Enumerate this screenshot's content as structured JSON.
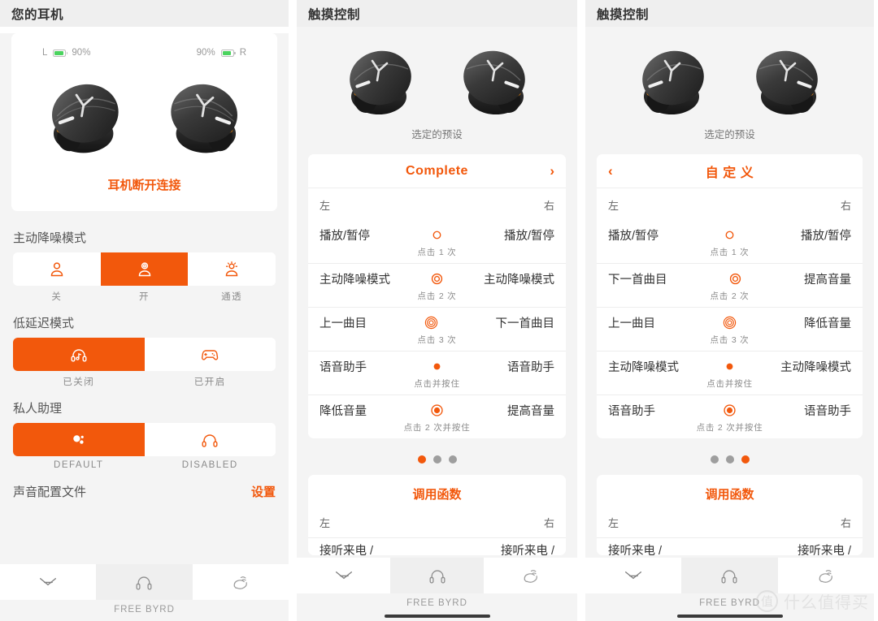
{
  "accent": "#f2580c",
  "battery_green": "#4bd35f",
  "panel1": {
    "header": {
      "title": "您的耳机"
    },
    "battery": {
      "left": {
        "side_label": "L",
        "percent": "90%"
      },
      "right": {
        "side_label": "R",
        "percent": "90%"
      }
    },
    "status": {
      "text": "耳机断开连接"
    },
    "anc": {
      "section_label": "主动降噪模式",
      "options": [
        {
          "label": "关",
          "icon": "anc-off-icon",
          "active": false
        },
        {
          "label": "开",
          "icon": "anc-on-icon",
          "active": true
        },
        {
          "label": "通透",
          "icon": "anc-transparency-icon",
          "active": false
        }
      ]
    },
    "low_latency": {
      "section_label": "低延迟模式",
      "options": [
        {
          "label": "已关闭",
          "icon": "headphones-music-icon",
          "active": true
        },
        {
          "label": "已开启",
          "icon": "gamepad-icon",
          "active": false
        }
      ]
    },
    "assistant": {
      "section_label": "私人助理",
      "options": [
        {
          "label": "DEFAULT",
          "icon": "assistant-dots-icon",
          "active": true
        },
        {
          "label": "DISABLED",
          "icon": "headphones-icon",
          "active": false
        }
      ]
    },
    "sound_profile": {
      "label": "声音配置文件",
      "action": "设置"
    }
  },
  "panel2": {
    "header": {
      "title": "触摸控制"
    },
    "preset_caption": "选定的预设",
    "preset_name": "Complete",
    "chevron_right": "›",
    "columns": {
      "left": "左",
      "right": "右"
    },
    "rows": [
      {
        "left": "播放/暂停",
        "gesture": "tap-1-icon",
        "sub": "点击 1 次",
        "right": "播放/暂停"
      },
      {
        "left": "主动降噪模式",
        "gesture": "tap-2-icon",
        "sub": "点击 2 次",
        "right": "主动降噪模式"
      },
      {
        "left": "上一曲目",
        "gesture": "tap-3-icon",
        "sub": "点击 3 次",
        "right": "下一首曲目"
      },
      {
        "left": "语音助手",
        "gesture": "tap-hold-icon",
        "sub": "点击并按住",
        "right": "语音助手"
      },
      {
        "left": "降低音量",
        "gesture": "tap-2-hold-icon",
        "sub": "点击 2 次并按住",
        "right": "提高音量"
      }
    ],
    "dots": [
      true,
      false,
      false
    ],
    "function_title": "调用函数",
    "clipped_row": {
      "left": "接听来电 /",
      "right": "接听来电 /"
    },
    "nav": {
      "tabs": [
        "beyerdynamic-logo-icon",
        "headphones-icon",
        "touch-hand-icon"
      ],
      "active_index": 1,
      "device_name": "FREE BYRD"
    }
  },
  "panel3": {
    "header": {
      "title": "触摸控制"
    },
    "preset_caption": "选定的预设",
    "preset_name": "自 定 义",
    "chevron_left": "‹",
    "columns": {
      "left": "左",
      "right": "右"
    },
    "rows": [
      {
        "left": "播放/暂停",
        "gesture": "tap-1-icon",
        "sub": "点击 1 次",
        "right": "播放/暂停"
      },
      {
        "left": "下一首曲目",
        "gesture": "tap-2-icon",
        "sub": "点击 2 次",
        "right": "提高音量"
      },
      {
        "left": "上一曲目",
        "gesture": "tap-3-icon",
        "sub": "点击 3 次",
        "right": "降低音量"
      },
      {
        "left": "主动降噪模式",
        "gesture": "tap-hold-icon",
        "sub": "点击并按住",
        "right": "主动降噪模式"
      },
      {
        "left": "语音助手",
        "gesture": "tap-2-hold-icon",
        "sub": "点击 2 次并按住",
        "right": "语音助手"
      }
    ],
    "dots": [
      false,
      false,
      true
    ],
    "function_title": "调用函数",
    "clipped_row": {
      "left": "接听来电 /",
      "right": "接听来电 /"
    },
    "nav": {
      "tabs": [
        "beyerdynamic-logo-icon",
        "headphones-icon",
        "touch-hand-icon"
      ],
      "active_index": 1,
      "device_name": "FREE BYRD"
    },
    "watermark": {
      "logo": "值",
      "text": "什么值得买"
    }
  },
  "nav_common": {
    "device_name": "FREE BYRD"
  }
}
